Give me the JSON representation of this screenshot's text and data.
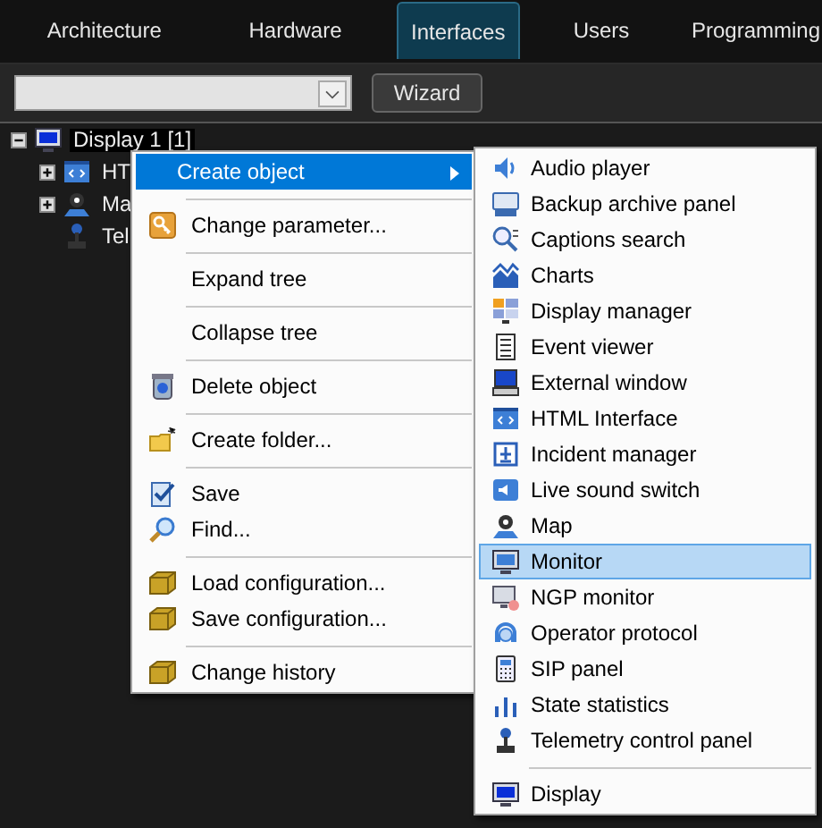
{
  "tabs": [
    {
      "label": "Architecture",
      "selected": false
    },
    {
      "label": "Hardware",
      "selected": false
    },
    {
      "label": "Interfaces",
      "selected": true
    },
    {
      "label": "Users",
      "selected": false
    },
    {
      "label": "Programming",
      "selected": false
    }
  ],
  "toolbar": {
    "wizard_button": "Wizard"
  },
  "tree": [
    {
      "label": "Display 1 [1]",
      "kind": "group",
      "expanded": true,
      "selected": true,
      "children": [
        {
          "label": "HT",
          "kind": "group",
          "expanded": false,
          "selected": false
        },
        {
          "label": "Ma",
          "kind": "group",
          "expanded": false,
          "selected": false
        },
        {
          "label": "Tel",
          "kind": "leaf",
          "selected": false
        }
      ]
    }
  ],
  "context_menu": {
    "items": [
      {
        "kind": "submenu",
        "label": "Create object",
        "selected": true
      },
      {
        "kind": "separator"
      },
      {
        "kind": "item",
        "label": "Change parameter...",
        "selected": false
      },
      {
        "kind": "separator"
      },
      {
        "kind": "item",
        "label": "Expand tree",
        "selected": false
      },
      {
        "kind": "separator"
      },
      {
        "kind": "item",
        "label": "Collapse tree",
        "selected": false
      },
      {
        "kind": "separator"
      },
      {
        "kind": "item",
        "label": "Delete object",
        "selected": false
      },
      {
        "kind": "separator"
      },
      {
        "kind": "item",
        "label": "Create folder...",
        "selected": false
      },
      {
        "kind": "separator"
      },
      {
        "kind": "item",
        "label": "Save",
        "selected": false
      },
      {
        "kind": "item",
        "label": "Find...",
        "selected": false
      },
      {
        "kind": "separator"
      },
      {
        "kind": "item",
        "label": "Load configuration...",
        "selected": false
      },
      {
        "kind": "item",
        "label": "Save configuration...",
        "selected": false
      },
      {
        "kind": "separator"
      },
      {
        "kind": "item",
        "label": "Change history",
        "selected": false
      }
    ]
  },
  "submenu": {
    "items": [
      {
        "kind": "item",
        "label": "Audio player",
        "selected": false
      },
      {
        "kind": "item",
        "label": "Backup archive panel",
        "selected": false
      },
      {
        "kind": "item",
        "label": "Captions search",
        "selected": false
      },
      {
        "kind": "item",
        "label": "Charts",
        "selected": false
      },
      {
        "kind": "item",
        "label": "Display manager",
        "selected": false
      },
      {
        "kind": "item",
        "label": "Event viewer",
        "selected": false
      },
      {
        "kind": "item",
        "label": "External window",
        "selected": false
      },
      {
        "kind": "item",
        "label": "HTML Interface",
        "selected": false
      },
      {
        "kind": "item",
        "label": "Incident manager",
        "selected": false
      },
      {
        "kind": "item",
        "label": "Live sound switch",
        "selected": false
      },
      {
        "kind": "item",
        "label": "Map",
        "selected": false
      },
      {
        "kind": "item",
        "label": "Monitor",
        "selected": true
      },
      {
        "kind": "item",
        "label": "NGP monitor",
        "selected": false
      },
      {
        "kind": "item",
        "label": "Operator protocol",
        "selected": false
      },
      {
        "kind": "item",
        "label": "SIP panel",
        "selected": false
      },
      {
        "kind": "item",
        "label": "State statistics",
        "selected": false
      },
      {
        "kind": "item",
        "label": "Telemetry control panel",
        "selected": false
      },
      {
        "kind": "separator"
      },
      {
        "kind": "item",
        "label": "Display",
        "selected": false
      }
    ]
  }
}
